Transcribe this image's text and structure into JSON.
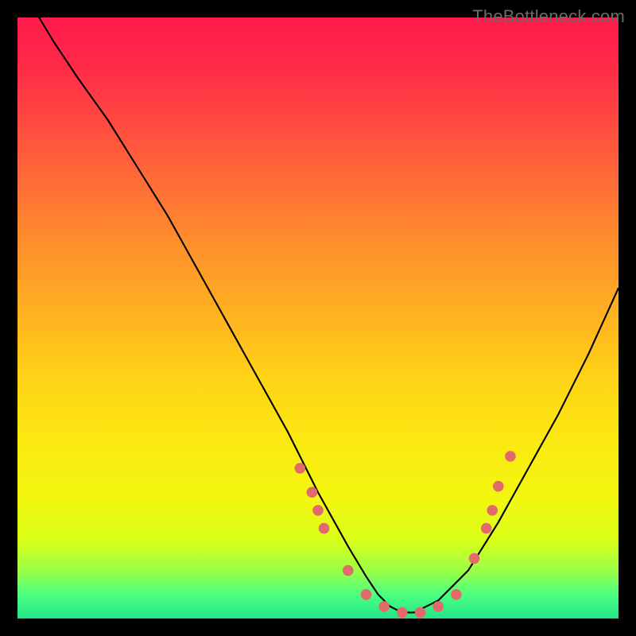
{
  "watermark": "TheBottleneck.com",
  "chart_data": {
    "type": "line",
    "title": "",
    "xlabel": "",
    "ylabel": "",
    "xlim": [
      0,
      100
    ],
    "ylim": [
      0,
      100
    ],
    "series": [
      {
        "name": "curve",
        "x": [
          0,
          3,
          6,
          10,
          15,
          20,
          25,
          30,
          35,
          40,
          45,
          50,
          55,
          58,
          60,
          62,
          64,
          66,
          70,
          75,
          80,
          85,
          90,
          95,
          100
        ],
        "y": [
          108,
          101,
          96,
          90,
          83,
          75,
          67,
          58,
          49,
          40,
          31,
          21,
          12,
          7,
          4,
          2,
          1,
          1,
          3,
          8,
          16,
          25,
          34,
          44,
          55
        ]
      }
    ],
    "points": {
      "name": "dots",
      "color": "#e26a6a",
      "x": [
        47,
        49,
        50,
        51,
        55,
        58,
        61,
        64,
        67,
        70,
        73,
        76,
        78,
        79,
        80,
        82
      ],
      "y": [
        25,
        21,
        18,
        15,
        8,
        4,
        2,
        1,
        1,
        2,
        4,
        10,
        15,
        18,
        22,
        27
      ]
    },
    "gradient_stops": [
      {
        "pos": 0.0,
        "color": "#ff1a4b"
      },
      {
        "pos": 0.22,
        "color": "#ff5a3c"
      },
      {
        "pos": 0.5,
        "color": "#ffb320"
      },
      {
        "pos": 0.8,
        "color": "#f3f70f"
      },
      {
        "pos": 0.96,
        "color": "#4cff82"
      },
      {
        "pos": 1.0,
        "color": "#22e588"
      }
    ]
  }
}
